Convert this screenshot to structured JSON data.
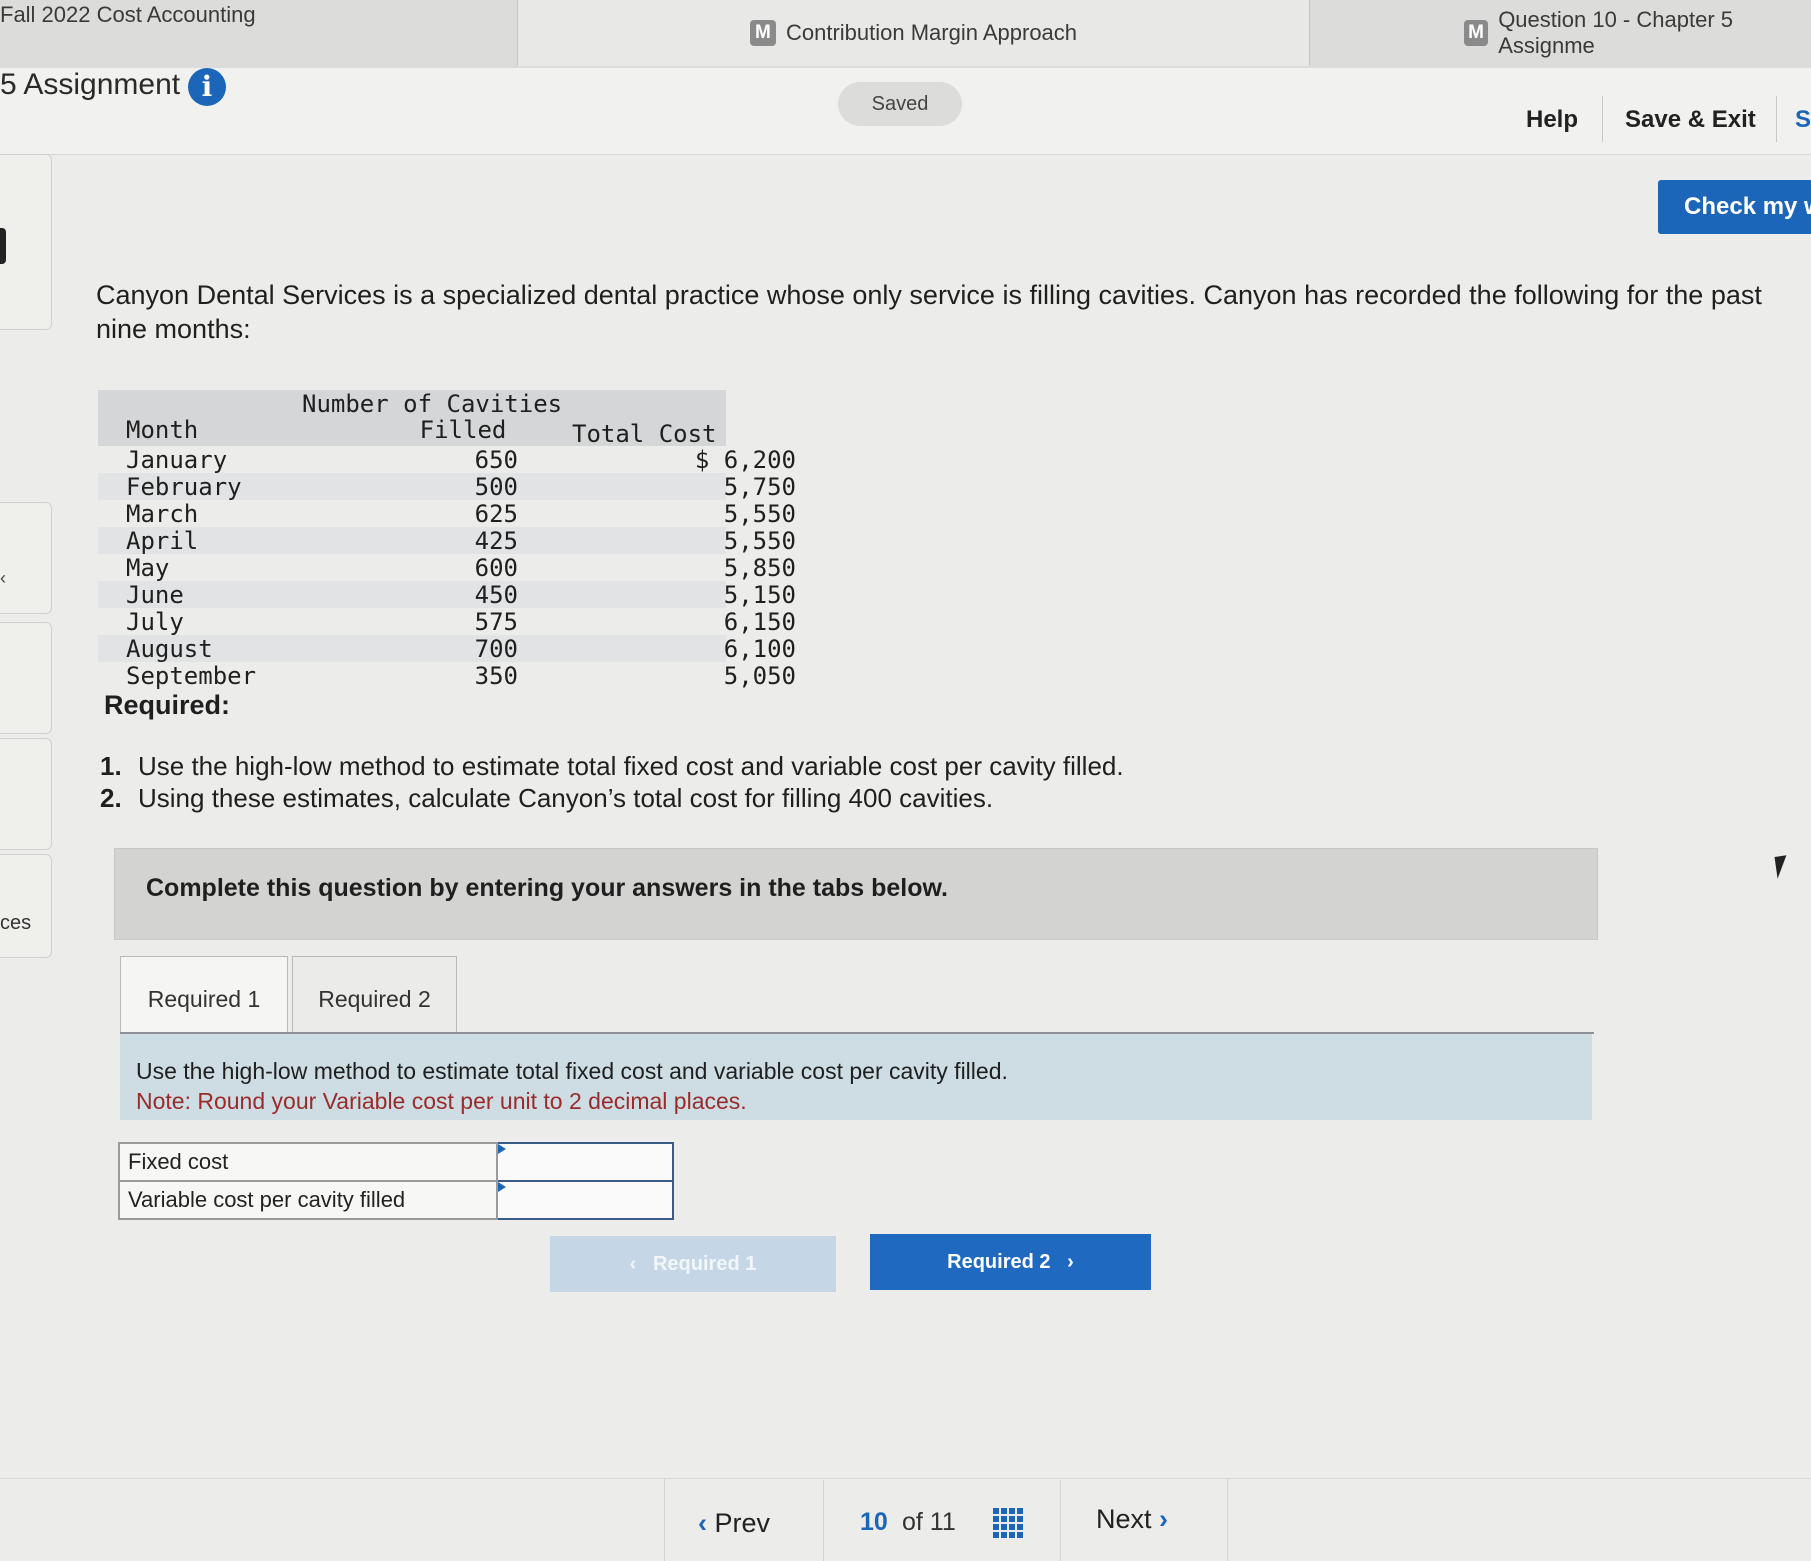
{
  "browser_tabs": [
    {
      "label": "Fall 2022 Cost Accounting",
      "badge": ""
    },
    {
      "label": "Contribution Margin Approach",
      "badge": "M"
    },
    {
      "label": "Question 10 - Chapter 5 Assignme",
      "badge": "M"
    }
  ],
  "header": {
    "assignment_title": "5 Assignment",
    "info_icon": "i",
    "saved_label": "Saved",
    "help_label": "Help",
    "save_exit_label": "Save & Exit",
    "submit_partial": "S",
    "check_label": "Check my w"
  },
  "sidebar": {
    "partial_text": "ces"
  },
  "question": {
    "intro": "Canyon Dental Services is a specialized dental practice whose only service is filling cavities. Canyon has recorded the following for the past nine months:",
    "table": {
      "header_line1": "Number of Cavities",
      "col_month": "Month",
      "col_cavities": "Filled",
      "col_cost": "Total Cost",
      "rows": [
        {
          "month": "January",
          "cavities": "650",
          "cost": "$ 6,200"
        },
        {
          "month": "February",
          "cavities": "500",
          "cost": "5,750"
        },
        {
          "month": "March",
          "cavities": "625",
          "cost": "5,550"
        },
        {
          "month": "April",
          "cavities": "425",
          "cost": "5,550"
        },
        {
          "month": "May",
          "cavities": "600",
          "cost": "5,850"
        },
        {
          "month": "June",
          "cavities": "450",
          "cost": "5,150"
        },
        {
          "month": "July",
          "cavities": "575",
          "cost": "6,150"
        },
        {
          "month": "August",
          "cavities": "700",
          "cost": "6,100"
        },
        {
          "month": "September",
          "cavities": "350",
          "cost": "5,050"
        }
      ]
    },
    "required_label": "Required:",
    "requirements": [
      {
        "num": "1.",
        "text": "Use the high-low method to estimate total fixed cost and variable cost per cavity filled."
      },
      {
        "num": "2.",
        "text": "Using these estimates, calculate Canyon’s total cost for filling 400 cavities."
      }
    ],
    "band_text": "Complete this question by entering your answers in the tabs below."
  },
  "answer_tabs": [
    {
      "label": "Required 1",
      "active": true
    },
    {
      "label": "Required 2",
      "active": false
    }
  ],
  "required1": {
    "instruction": "Use the high-low method to estimate total fixed cost and variable cost per cavity filled.",
    "note": "Note: Round your Variable cost per unit to 2 decimal places.",
    "rows": [
      {
        "label": "Fixed cost",
        "value": ""
      },
      {
        "label": "Variable cost per cavity filled",
        "value": ""
      }
    ],
    "prev_button": "Required 1",
    "next_button": "Required 2"
  },
  "pagination": {
    "prev_label": "Prev",
    "current": "10",
    "of_label": "of 11",
    "next_label": "Next"
  },
  "colors": {
    "accent": "#1b66b9",
    "note_red": "#9a2b2b",
    "instruction_bg": "#cddde3"
  }
}
